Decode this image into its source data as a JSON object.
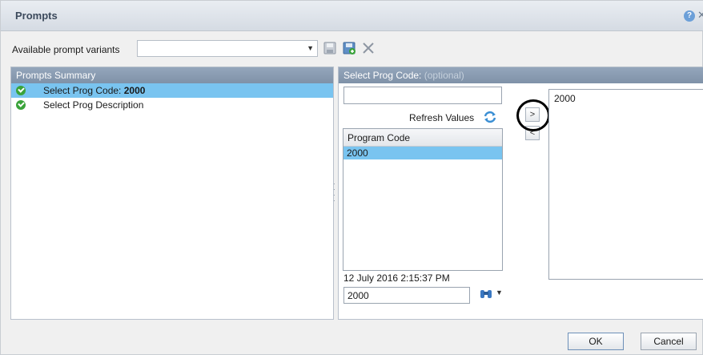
{
  "dialog": {
    "title": "Prompts",
    "help_icon": "?"
  },
  "variants": {
    "label": "Available prompt variants",
    "selected_value": "",
    "icons": [
      "save-icon",
      "save-as-icon",
      "delete-icon"
    ]
  },
  "summary": {
    "header": "Prompts Summary",
    "items": [
      {
        "label": "Select Prog Code: ",
        "value": "2000",
        "status_icon": "check-icon",
        "selected": true
      },
      {
        "label": "Select Prog Description",
        "value": "",
        "status_icon": "check-icon",
        "selected": false
      }
    ]
  },
  "prompt": {
    "header": "Select Prog Code:",
    "optional": "(optional)",
    "search_value": "",
    "refresh_label": "Refresh Values",
    "list_header": "Program Code",
    "list_items": [
      "2000"
    ],
    "timestamp": "12 July 2016 2:15:37 PM",
    "manual_value": "2000",
    "add_button": ">",
    "remove_button": "<",
    "selected_values": [
      "2000"
    ]
  },
  "footer": {
    "ok_label": "OK",
    "cancel_label": "Cancel"
  },
  "colors": {
    "selection": "#79c4f0",
    "header": "#8a9cb1",
    "success": "#3aa33a"
  }
}
